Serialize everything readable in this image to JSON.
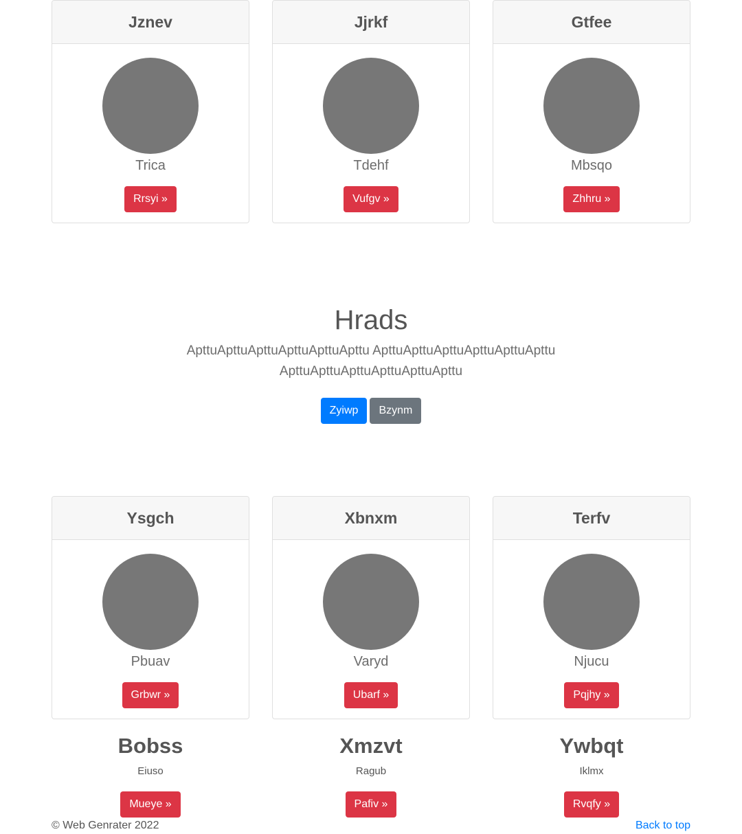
{
  "top_cards": [
    {
      "title": "Jznev",
      "caption": "Trica",
      "button": "Rrsyi »"
    },
    {
      "title": "Jjrkf",
      "caption": "Tdehf",
      "button": "Vufgv »"
    },
    {
      "title": "Gtfee",
      "caption": "Mbsqo",
      "button": "Zhhru »"
    }
  ],
  "hero": {
    "title": "Hrads",
    "text": "ApttuApttuApttuApttuApttuApttu ApttuApttuApttuApttuApttuApttu ApttuApttuApttuApttuApttuApttu",
    "primary_button": "Zyiwp",
    "secondary_button": "Bzynm"
  },
  "bottom_cards": [
    {
      "title": "Ysgch",
      "caption": "Pbuav",
      "button": "Grbwr »"
    },
    {
      "title": "Xbnxm",
      "caption": "Varyd",
      "button": "Ubarf »"
    },
    {
      "title": "Terfv",
      "caption": "Njucu",
      "button": "Pqjhy »"
    }
  ],
  "features": [
    {
      "title": "Bobss",
      "subtitle": "Eiuso",
      "button": "Mueye »"
    },
    {
      "title": "Xmzvt",
      "subtitle": "Ragub",
      "button": "Pafiv »"
    },
    {
      "title": "Ywbqt",
      "subtitle": "Iklmx",
      "button": "Rvqfy »"
    }
  ],
  "footer": {
    "copyright": "© Web Genrater 2022",
    "back_to_top": "Back to top"
  },
  "colors": {
    "danger": "#dc3545",
    "primary": "#007bff",
    "secondary": "#6c757d",
    "avatar": "#777777"
  }
}
